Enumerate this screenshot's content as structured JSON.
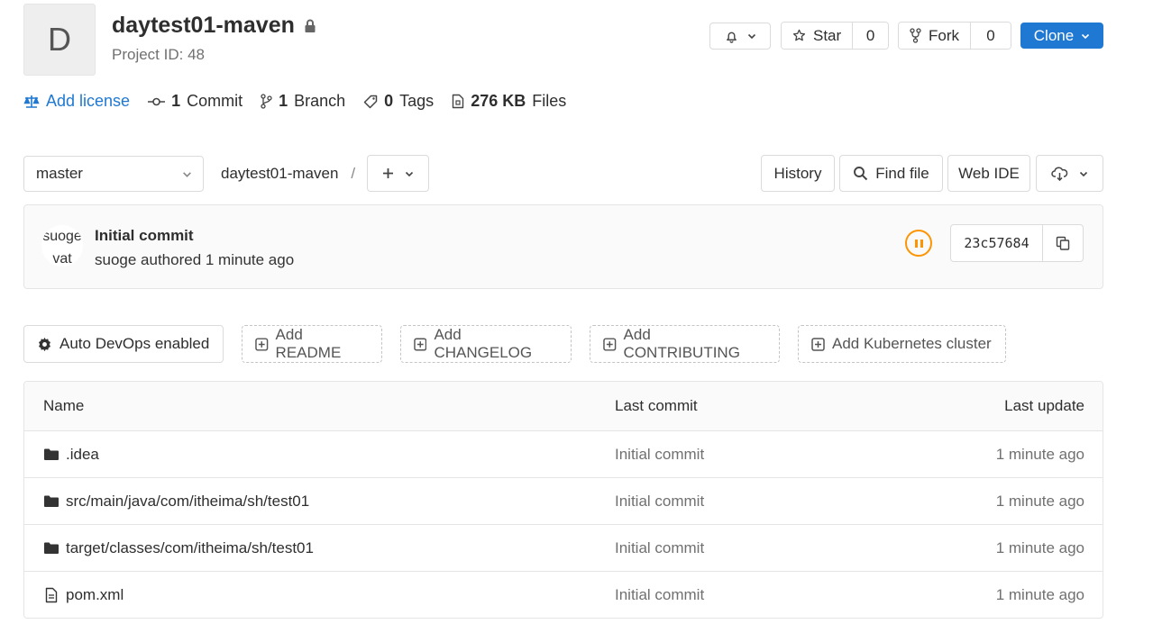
{
  "project": {
    "avatar_letter": "D",
    "name": "daytest01-maven",
    "id_label": "Project ID: 48"
  },
  "actions": {
    "star_label": "Star",
    "star_count": "0",
    "fork_label": "Fork",
    "fork_count": "0",
    "clone_label": "Clone"
  },
  "stats": {
    "add_license": "Add license",
    "commits_count": "1",
    "commits_label": "Commit",
    "branches_count": "1",
    "branches_label": "Branch",
    "tags_count": "0",
    "tags_label": "Tags",
    "files_size": "276 KB",
    "files_label": "Files"
  },
  "tree_nav": {
    "branch": "master",
    "breadcrumb_root": "daytest01-maven",
    "separator": "/",
    "history_label": "History",
    "find_file_label": "Find file",
    "web_ide_label": "Web IDE"
  },
  "last_commit": {
    "avatar_text": "suoge vat",
    "title": "Initial commit",
    "meta": "suoge authored 1 minute ago",
    "sha": "23c57684",
    "pipeline_status": "paused",
    "status_color": "#fc9403"
  },
  "quick_actions": {
    "auto_devops": "Auto DevOps enabled",
    "add_readme": "Add README",
    "add_changelog": "Add CHANGELOG",
    "add_contributing": "Add CONTRIBUTING",
    "add_kubernetes": "Add Kubernetes cluster"
  },
  "file_table": {
    "headers": {
      "name": "Name",
      "last_commit": "Last commit",
      "last_update": "Last update"
    },
    "rows": [
      {
        "type": "folder",
        "name": ".idea",
        "commit": "Initial commit",
        "updated": "1 minute ago"
      },
      {
        "type": "folder",
        "name": "src/main/java/com/itheima/sh/test01",
        "commit": "Initial commit",
        "updated": "1 minute ago"
      },
      {
        "type": "folder",
        "name": "target/classes/com/itheima/sh/test01",
        "commit": "Initial commit",
        "updated": "1 minute ago"
      },
      {
        "type": "file",
        "name": "pom.xml",
        "commit": "Initial commit",
        "updated": "1 minute ago"
      }
    ]
  },
  "colors": {
    "link": "#1f78d1",
    "primary_button": "#1f78d1"
  }
}
